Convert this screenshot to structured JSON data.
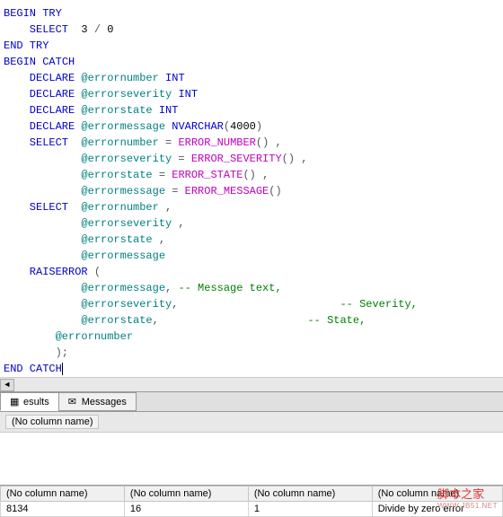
{
  "code": {
    "l1": {
      "a": "BEGIN",
      "b": " TRY"
    },
    "l2": {
      "a": "    SELECT",
      "b": "  3 ",
      "c": "/",
      "d": " 0"
    },
    "l3": {
      "a": "END",
      "b": " TRY"
    },
    "l4": {
      "a": "BEGIN",
      "b": " CATCH"
    },
    "l5": {
      "a": "    DECLARE",
      "b": " @errornumber",
      "c": " INT"
    },
    "l6": {
      "a": "    DECLARE",
      "b": " @errorseverity",
      "c": " INT"
    },
    "l7": {
      "a": "    DECLARE",
      "b": " @errorstate",
      "c": " INT"
    },
    "l8": {
      "a": "    DECLARE",
      "b": " @errormessage",
      "c": " NVARCHAR",
      "d": "(",
      "e": "4000",
      "f": ")"
    },
    "l9": {
      "a": "    SELECT",
      "b": "  @errornumber",
      "c": " = ",
      "d": "ERROR_NUMBER",
      "e": "() ,"
    },
    "l10": {
      "a": "            @errorseverity",
      "b": " = ",
      "c": "ERROR_SEVERITY",
      "d": "() ,"
    },
    "l11": {
      "a": "            @errorstate",
      "b": " = ",
      "c": "ERROR_STATE",
      "d": "() ,"
    },
    "l12": {
      "a": "            @errormessage",
      "b": " = ",
      "c": "ERROR_MESSAGE",
      "d": "()"
    },
    "l13": {
      "a": ""
    },
    "l14": {
      "a": "    SELECT",
      "b": "  @errornumber",
      "c": " ,"
    },
    "l15": {
      "a": "            @errorseverity",
      "b": " ,"
    },
    "l16": {
      "a": "            @errorstate",
      "b": " ,"
    },
    "l17": {
      "a": "            @errormessage"
    },
    "l18": {
      "a": ""
    },
    "l19": {
      "a": "    RAISERROR",
      "b": " ("
    },
    "l20": {
      "a": "            @errormessage",
      "b": ", ",
      "c": "-- Message text,"
    },
    "l21": {
      "a": "            @errorseverity",
      "b": ",                         ",
      "c": "-- Severity,"
    },
    "l22": {
      "a": "            @errorstate",
      "b": ",                       ",
      "c": "-- State,"
    },
    "l23": {
      "a": "        @errornumber"
    },
    "l24": {
      "a": "        );"
    },
    "l25": {
      "a": "END",
      "b": " CATCH"
    }
  },
  "scroll": {
    "left": "◄",
    "right": "►"
  },
  "tabs": {
    "results": "esults",
    "messages": "Messages"
  },
  "gridHeader": {
    "col": "(No column name)"
  },
  "result": {
    "headers": [
      "(No column name)",
      "(No column name)",
      "(No column name)",
      "(No column name)"
    ],
    "row": [
      "8134",
      "16",
      "1",
      "Divide by zero error"
    ]
  },
  "watermark": {
    "main": "脚本之家",
    "sub": "WWW.JB51.NET"
  }
}
